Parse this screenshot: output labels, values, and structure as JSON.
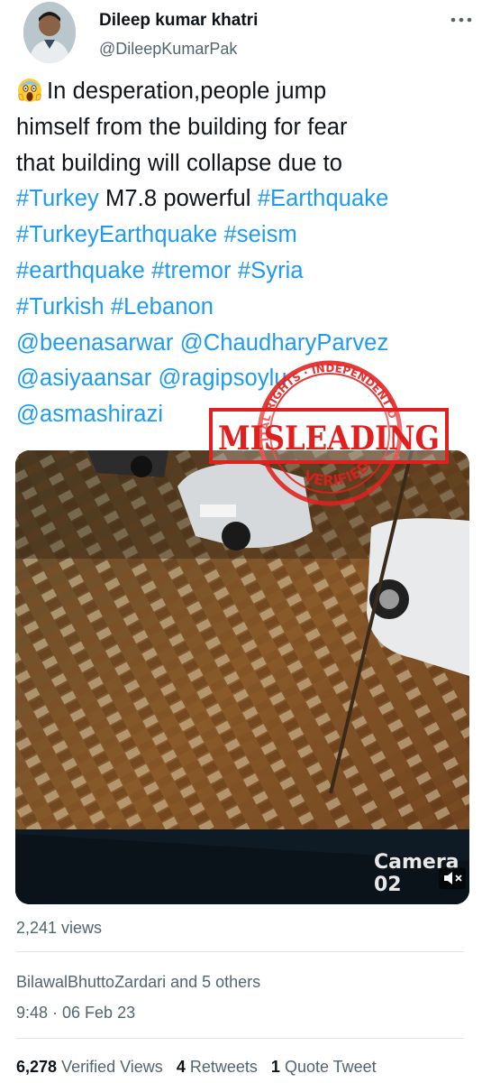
{
  "author": {
    "name": "Dileep kumar khatri",
    "handle": "@DileepKumarPak"
  },
  "tweet": {
    "emoji": "screaming-face-emoji",
    "lines": [
      {
        "text": "In desperation,people jump"
      },
      {
        "text": "himself from the building for fear"
      },
      {
        "text": "that building will collapse due to"
      },
      {
        "tag1": "#Turkey",
        "plain": " M7.8 powerful ",
        "tag2": "#Earthquake"
      },
      {
        "tag1": "#TurkeyEarthquake",
        "tag2": "#seism"
      },
      {
        "tag1": "#earthquake",
        "tag2": "#tremor",
        "tag3": "#Syria"
      },
      {
        "tag1": "#Turkish",
        "tag2": "#Lebanon"
      },
      {
        "tag1": "@beenasarwar",
        "tag2": "@ChaudharyParvez"
      },
      {
        "tag1": "@asiyaansar",
        "tag2": "@ragipsoylu"
      },
      {
        "tag1": "@asmashirazi"
      }
    ]
  },
  "stamp": {
    "top_text": "DIGITAL RIGHTS · INDEPENDENT DATA",
    "main_text": "MISLEADING",
    "bottom_text": "VERIFIED",
    "color": "#e0201f"
  },
  "media": {
    "camera_label": "Camera 02"
  },
  "stats": {
    "views": "2,241 views",
    "liked_by": "BilawalBhuttoZardari and 5 others",
    "time": "9:48 · 06 Feb 23",
    "verified_views_count": "6,278",
    "verified_views_label": "Verified Views",
    "retweets_count": "4",
    "retweets_label": "Retweets",
    "quotes_count": "1",
    "quotes_label": "Quote Tweet"
  },
  "colors": {
    "link": "#1d9bf0",
    "secondary_text": "#536471",
    "primary_text": "#0f1419"
  }
}
